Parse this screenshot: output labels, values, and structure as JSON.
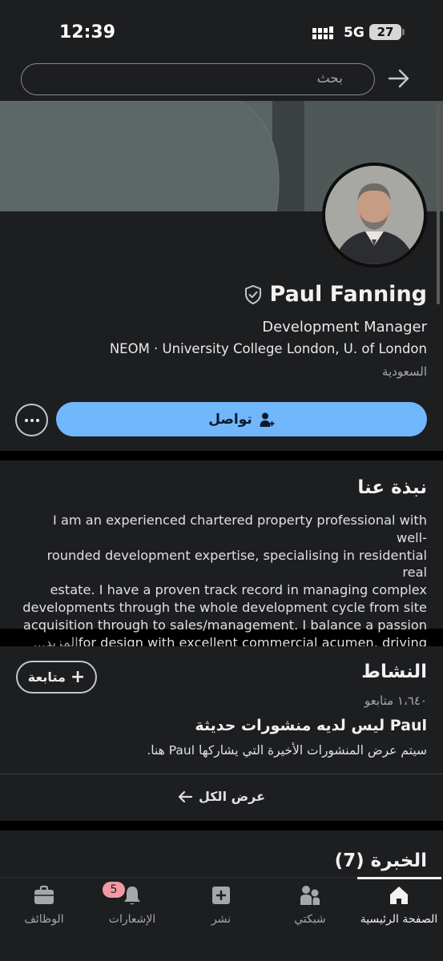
{
  "status_bar": {
    "time": "12:39",
    "network": "5G",
    "battery": "27"
  },
  "search": {
    "placeholder": "بحث"
  },
  "profile": {
    "name": "Paul Fanning",
    "headline": "Development Manager",
    "education": "NEOM · University College London, U. of London",
    "location": "السعودية",
    "connect_label": "تواصل"
  },
  "about": {
    "title": "نبذة عنا",
    "lines": [
      "I am an experienced chartered property professional with well-",
      "rounded development expertise, specialising in residential real",
      "estate. I have a proven track record in managing complex",
      "developments through the whole development cycle from site",
      "acquisition through to sales/management. I balance a passion",
      "for design with excellent commercial acumen, driving"
    ],
    "ellipsis": "...",
    "more_label": "المزيد"
  },
  "activity": {
    "title": "النشاط",
    "follow_label": "متابعة",
    "followers": "١،٦٤٠ متابعو",
    "no_posts_title": "Paul ليس لديه منشورات حديثة",
    "no_posts_sub": "سيتم عرض المنشورات الأخيرة التي يشاركها Paul هنا.",
    "show_all": "عرض الكل"
  },
  "experience": {
    "title": "الخبرة (7)"
  },
  "nav": {
    "home": "الصفحة الرئيسية",
    "network": "شبكتي",
    "post": "نشر",
    "notifications": "الإشعارات",
    "notifications_badge": "5",
    "jobs": "الوظائف"
  }
}
